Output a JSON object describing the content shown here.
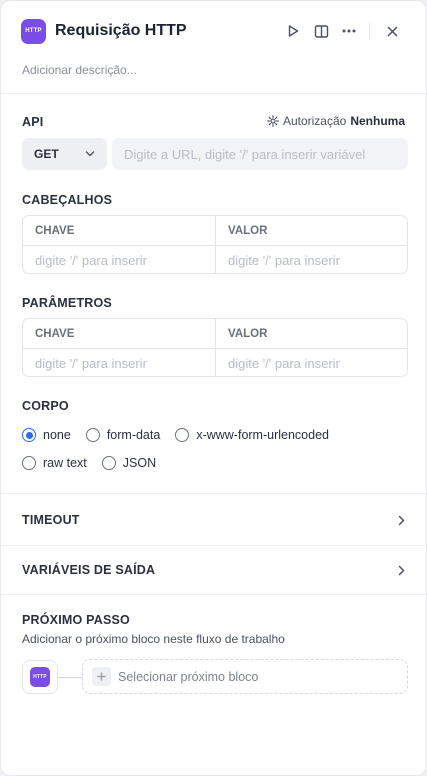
{
  "header": {
    "badge": "HTTP",
    "title": "Requisição HTTP",
    "actions": [
      "play-icon",
      "split-view-icon",
      "more-icon",
      "close-icon"
    ]
  },
  "description_placeholder": "Adicionar descrição...",
  "api": {
    "label": "API",
    "auth_label": "Autorização",
    "auth_value": "Nenhuma",
    "method": "GET",
    "url_placeholder": "Digite a URL, digite '/' para inserir variável"
  },
  "headers": {
    "label": "CABEÇALHOS",
    "key_col": "CHAVE",
    "value_col": "VALOR",
    "key_placeholder": "digite '/' para inserir",
    "value_placeholder": "digite '/' para inserir"
  },
  "params": {
    "label": "PARÂMETROS",
    "key_col": "CHAVE",
    "value_col": "VALOR",
    "key_placeholder": "digite '/' para inserir",
    "value_placeholder": "digite '/' para inserir"
  },
  "body": {
    "label": "CORPO",
    "options": [
      "none",
      "form-data",
      "x-www-form-urlencoded",
      "raw text",
      "JSON"
    ],
    "selected": "none"
  },
  "timeout": {
    "label": "TIMEOUT"
  },
  "output_vars": {
    "label": "VARIÁVEIS DE SAÍDA"
  },
  "next_step": {
    "label": "PRÓXIMO PASSO",
    "description": "Adicionar o próximo bloco neste fluxo de trabalho",
    "node_badge": "HTTP",
    "select_label": "Selecionar próximo bloco"
  },
  "colors": {
    "accent": "#7a4ee6",
    "radio_selected": "#2f6bf2"
  }
}
